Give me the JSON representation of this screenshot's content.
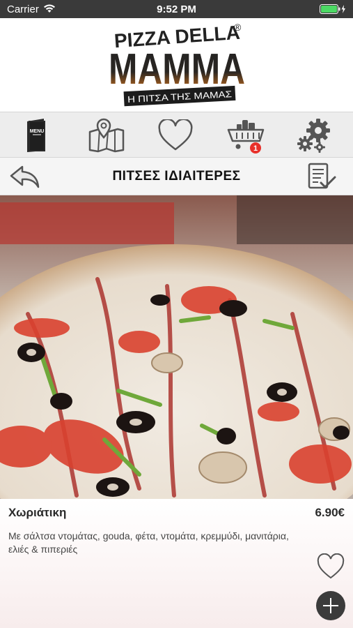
{
  "status_bar": {
    "carrier": "Carrier",
    "time": "9:52 PM"
  },
  "logo": {
    "line1": "PIZZA DELLA",
    "registered": "®",
    "line2": "MAMMA",
    "tagline": "Η ΠΙΤΣΑ ΤΗΣ ΜΑΜΑΣ"
  },
  "toolbar": {
    "items": [
      {
        "icon": "menu-book-icon",
        "label": "MENU"
      },
      {
        "icon": "map-icon"
      },
      {
        "icon": "heart-icon"
      },
      {
        "icon": "cart-icon",
        "badge": "1"
      },
      {
        "icon": "settings-icon"
      }
    ]
  },
  "header": {
    "title": "ΠΙΤΣΕΣ ΙΔΙΑΙΤΕΡΕΣ",
    "back_icon": "back-arrow-icon",
    "order_icon": "checklist-icon"
  },
  "product": {
    "name": "Χωριάτικη",
    "price": "6.90€",
    "description": "Με σάλτσα ντομάτας, gouda, φέτα, ντομάτα, κρεμμύδι, μανιτάρια, ελιές & πιπεριές"
  },
  "colors": {
    "status_bar": "#3a3a3a",
    "battery": "#4cd964",
    "badge": "#e8302a",
    "logo_dark": "#222222",
    "logo_orange": "#e07a1e"
  }
}
